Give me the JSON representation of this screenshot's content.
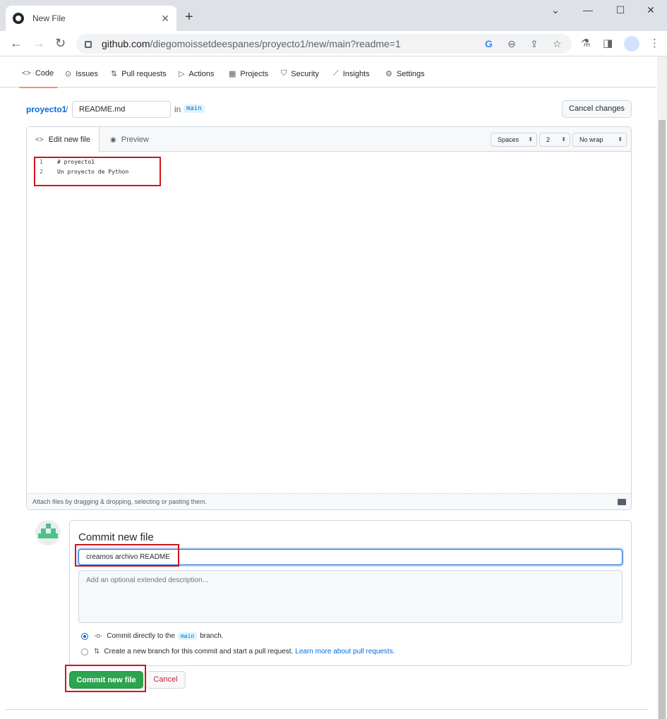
{
  "browser": {
    "tab_title": "New File",
    "tab_close": "✕",
    "new_tab": "+",
    "url_host": "github.com",
    "url_path": "/diegomoissetdeespanes/proyecto1/new/main?readme=1",
    "window_controls": [
      "⌄",
      "—",
      "☐",
      "✕"
    ]
  },
  "repo_nav": {
    "items": [
      {
        "label": "Code",
        "icon": "code-icon",
        "glyph": "<>"
      },
      {
        "label": "Issues",
        "icon": "issue-icon",
        "glyph": "⊙"
      },
      {
        "label": "Pull requests",
        "icon": "pull-request-icon",
        "glyph": "⇅"
      },
      {
        "label": "Actions",
        "icon": "play-icon",
        "glyph": "▷"
      },
      {
        "label": "Projects",
        "icon": "table-icon",
        "glyph": "▦"
      },
      {
        "label": "Security",
        "icon": "shield-icon",
        "glyph": "⛉"
      },
      {
        "label": "Insights",
        "icon": "graph-icon",
        "glyph": "⟋"
      },
      {
        "label": "Settings",
        "icon": "gear-icon",
        "glyph": "⚙"
      }
    ]
  },
  "breadcrumb": {
    "repo": "proyecto1",
    "separator": "/",
    "filename": "README.md",
    "in_label": "in",
    "branch": "main"
  },
  "cancel_changes_label": "Cancel changes",
  "editor": {
    "tab_edit": "Edit new file",
    "tab_preview": "Preview",
    "indent_mode": "Spaces",
    "indent_size": "2",
    "wrap_mode": "No wrap",
    "lines": [
      {
        "n": "1",
        "text": "# proyecto1"
      },
      {
        "n": "2",
        "text": "Un proyecto de Python"
      }
    ],
    "footer_text": "Attach files by dragging & dropping, selecting or pasting them."
  },
  "commit": {
    "title": "Commit new file",
    "message": "creamos archivo README",
    "description_placeholder": "Add an optional extended description...",
    "option_direct_pre": "Commit directly to the",
    "option_direct_branch": "main",
    "option_direct_post": "branch.",
    "option_new_branch": "Create a new branch for this commit and start a pull request.",
    "learn_more": "Learn more about pull requests.",
    "submit_label": "Commit new file",
    "cancel_label": "Cancel"
  },
  "colors": {
    "accent": "#0969da",
    "primary_button": "#2da44e",
    "highlight_box": "#d0161e",
    "danger": "#cf222e"
  }
}
